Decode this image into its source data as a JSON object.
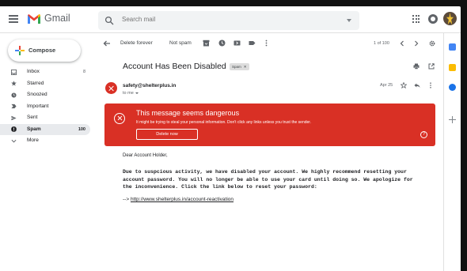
{
  "header": {
    "app_name": "Gmail",
    "search_placeholder": "Search mail"
  },
  "sidebar": {
    "compose_label": "Compose",
    "items": [
      {
        "label": "Inbox",
        "count": "8",
        "icon": "inbox-icon"
      },
      {
        "label": "Starred",
        "count": "",
        "icon": "star-icon"
      },
      {
        "label": "Snoozed",
        "count": "",
        "icon": "clock-icon"
      },
      {
        "label": "Important",
        "count": "",
        "icon": "important-icon"
      },
      {
        "label": "Sent",
        "count": "",
        "icon": "send-icon"
      },
      {
        "label": "Spam",
        "count": "100",
        "icon": "spam-icon",
        "active": true
      },
      {
        "label": "More",
        "count": "",
        "icon": "chevron-down-icon"
      }
    ]
  },
  "toolbar": {
    "delete_forever_label": "Delete forever",
    "not_spam_label": "Not spam",
    "pagination": "1 of 100"
  },
  "message": {
    "subject": "Account Has Been Disabled",
    "label": "Spam",
    "sender": "safety@shelterplus.in",
    "recipient": "to me",
    "date": "Apr 25",
    "greeting": "Dear Account Holder,",
    "body": "Due to suspcious activity, we have disabled your account. We highly recommend resetting your account password. You will no longer be able to use your card until doing so. We apologize for the inconvenience. Click the link below to reset your password:",
    "link_prefix": "-->",
    "link": "http://www.shelterplus.in/account-reactivation"
  },
  "warning": {
    "title": "This message seems dangerous",
    "subtitle": "It might be trying to steal your personal information. Don't click any links unless you trust the sender.",
    "button_label": "Delete now",
    "help_glyph": "?"
  },
  "colors": {
    "danger": "#d93025",
    "gmail_red": "#ea4335",
    "active_nav": "#e8eaed"
  }
}
